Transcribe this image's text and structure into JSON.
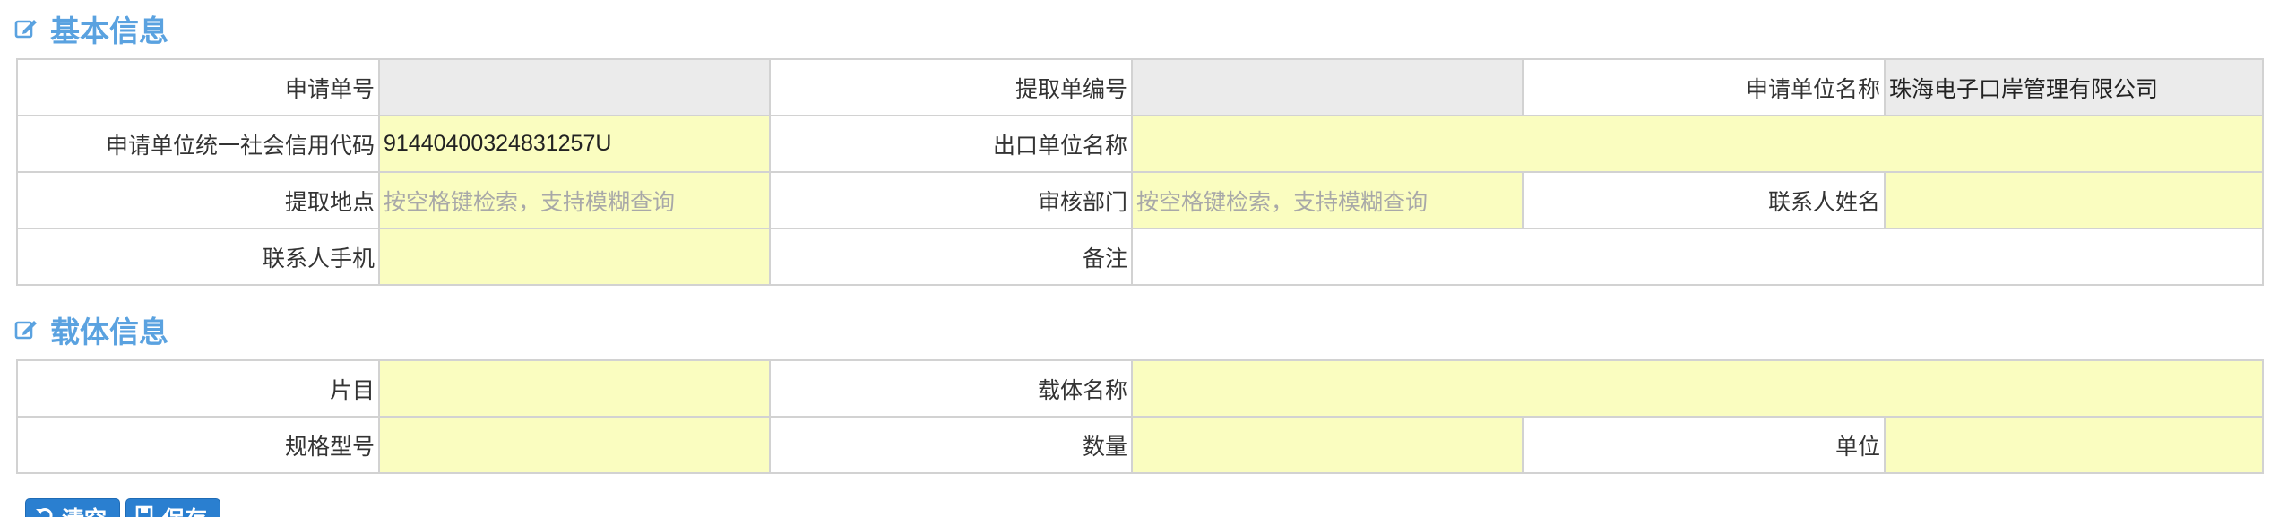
{
  "sections": {
    "basic": {
      "title": "基本信息",
      "icon": "edit-icon"
    },
    "carrier": {
      "title": "载体信息",
      "icon": "edit-icon"
    }
  },
  "basic_form": {
    "application_no": {
      "label": "申请单号",
      "value": ""
    },
    "extraction_no": {
      "label": "提取单编号",
      "value": ""
    },
    "applicant_unit_name": {
      "label": "申请单位名称",
      "value": "珠海电子口岸管理有限公司"
    },
    "applicant_credit_code": {
      "label": "申请单位统一社会信用代码",
      "value": "91440400324831257U"
    },
    "export_unit_name": {
      "label": "出口单位名称",
      "value": ""
    },
    "extraction_site": {
      "label": "提取地点",
      "placeholder": "按空格键检索，支持模糊查询"
    },
    "review_department": {
      "label": "审核部门",
      "placeholder": "按空格键检索，支持模糊查询"
    },
    "contact_name": {
      "label": "联系人姓名",
      "value": ""
    },
    "contact_mobile": {
      "label": "联系人手机",
      "value": ""
    },
    "remarks": {
      "label": "备注",
      "value": ""
    }
  },
  "carrier_form": {
    "piece_item": {
      "label": "片目",
      "value": ""
    },
    "carrier_name": {
      "label": "载体名称",
      "value": ""
    },
    "spec_model": {
      "label": "规格型号",
      "value": ""
    },
    "quantity": {
      "label": "数量",
      "value": ""
    },
    "unit": {
      "label": "单位",
      "value": ""
    }
  },
  "buttons": {
    "clear": {
      "label": "清空",
      "icon": "undo-icon"
    },
    "save": {
      "label": "保存",
      "icon": "save-icon"
    }
  },
  "colors": {
    "section_title": "#5aa2e0",
    "required_field_bg": "#fafdc0",
    "readonly_field_bg": "#ebebeb",
    "border": "#d2d2d2",
    "button_bg": "#2a7fd0"
  }
}
